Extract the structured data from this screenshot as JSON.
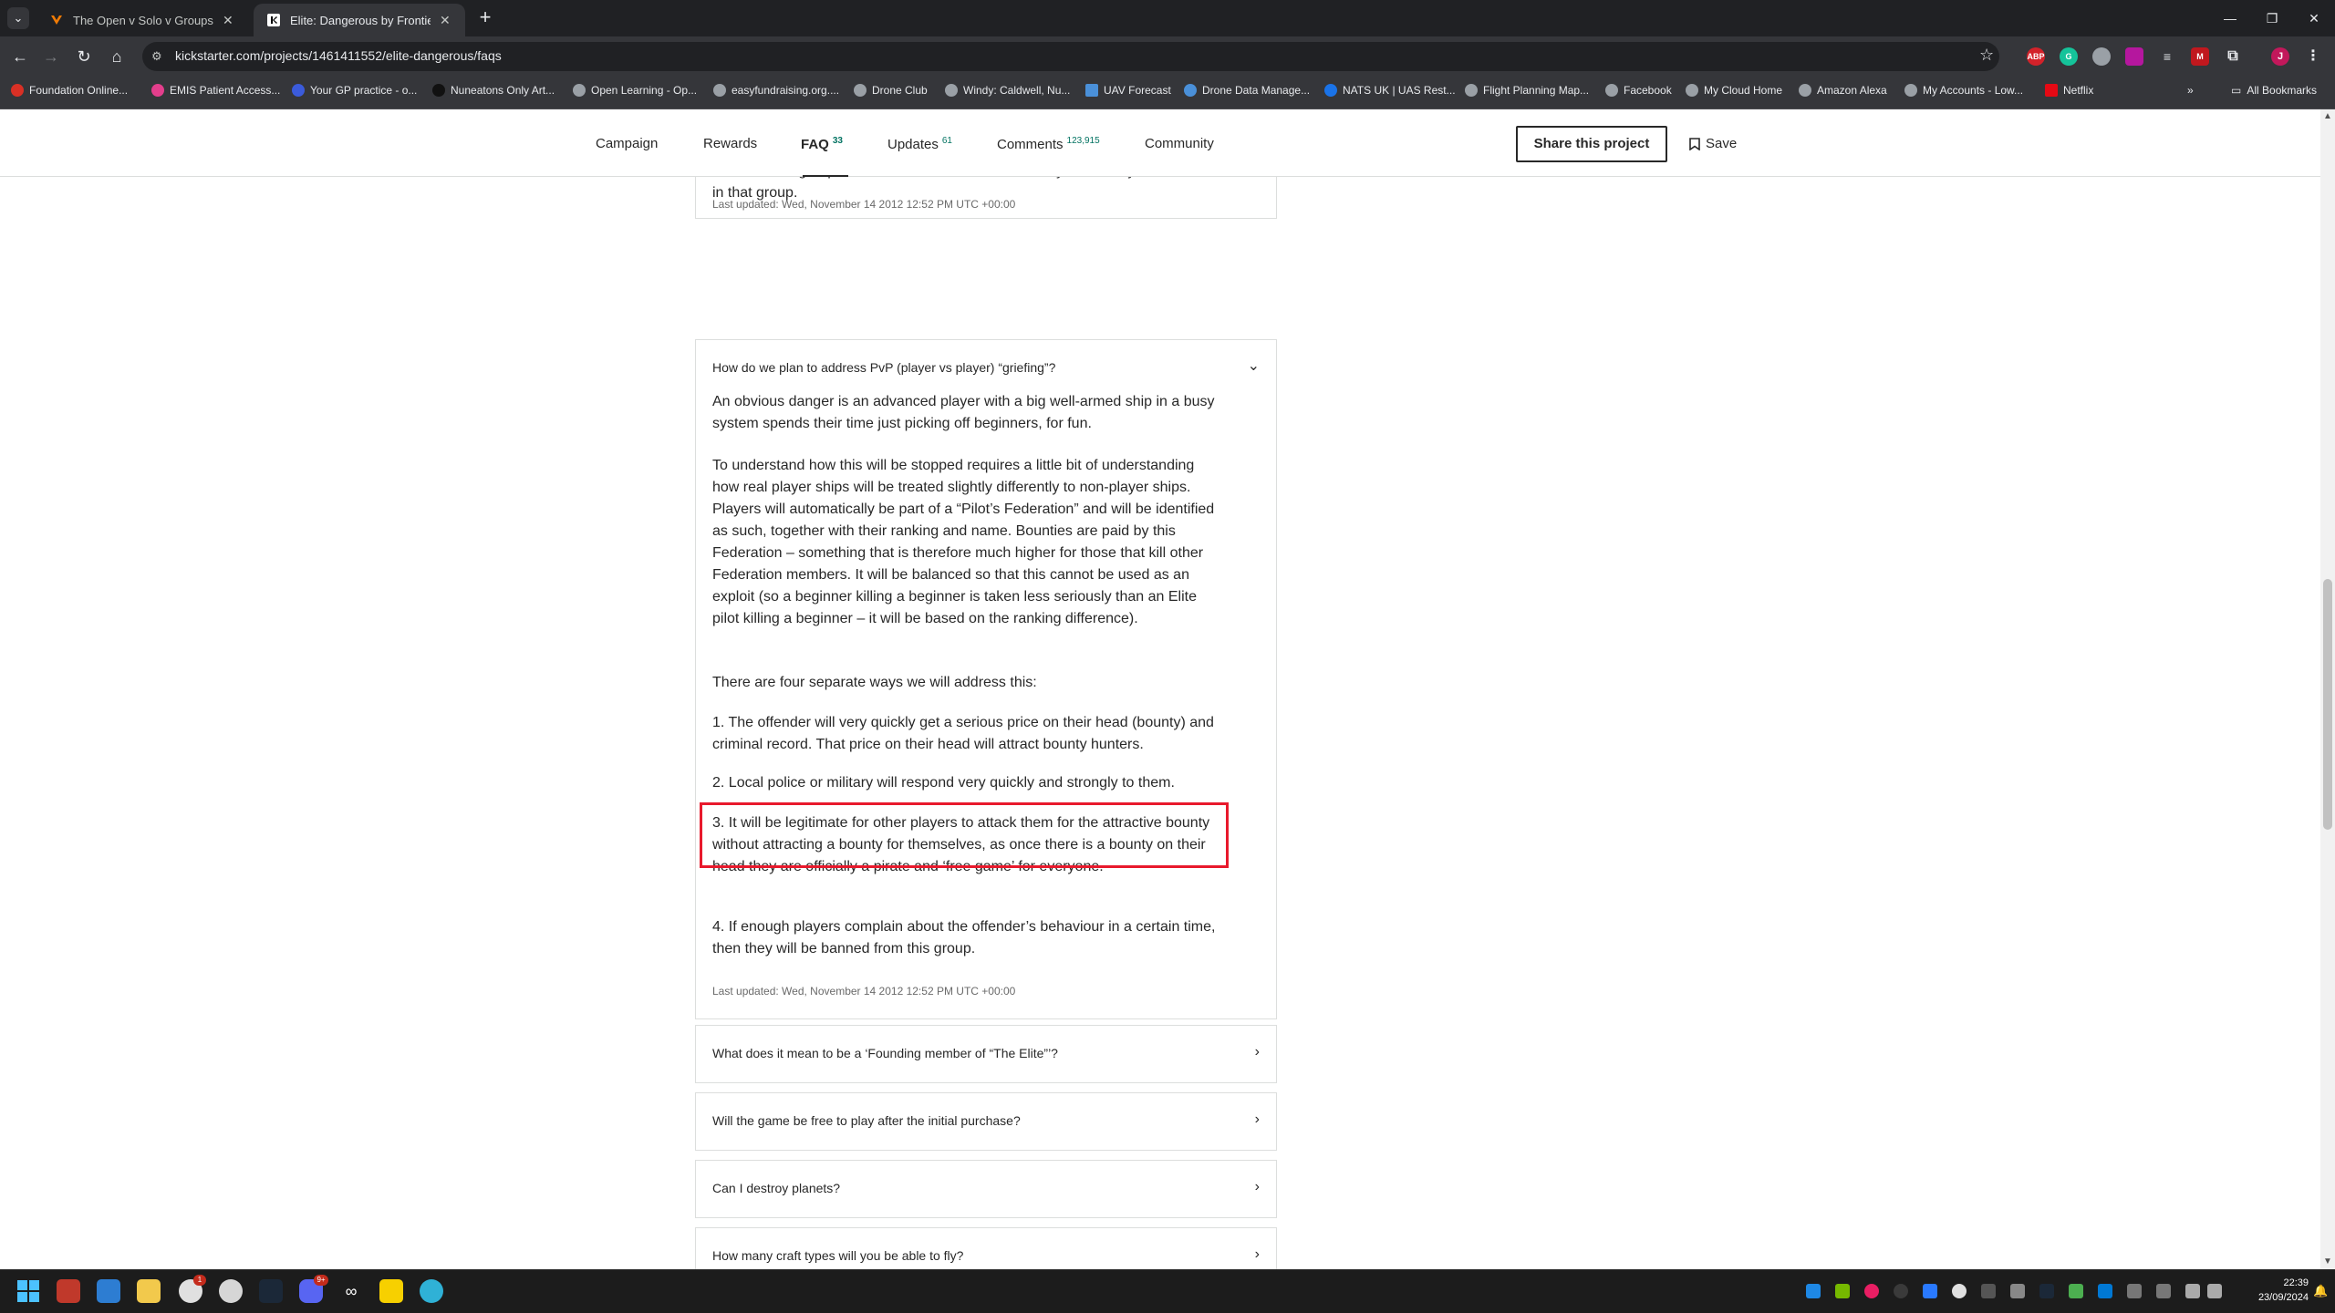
{
  "browser": {
    "tabs": [
      {
        "title": "The Open v Solo v Groups thre",
        "active": false
      },
      {
        "title": "Elite: Dangerous by Frontier De",
        "active": true
      }
    ],
    "url": "kickstarter.com/projects/1461411552/elite-dangerous/faqs",
    "bookmarks": [
      "Foundation Online...",
      "EMIS Patient Access...",
      "Your GP practice - o...",
      "Nuneatons Only Art...",
      "Open Learning - Op...",
      "easyfundraising.org....",
      "Drone Club",
      "Windy: Caldwell, Nu...",
      "UAV Forecast",
      "Drone Data Manage...",
      "NATS UK | UAS Rest...",
      "Flight Planning Map...",
      "Facebook",
      "My Cloud Home",
      "Amazon Alexa",
      "My Accounts - Low...",
      "Netflix"
    ],
    "all_bookmarks": "All Bookmarks",
    "profile_initial": "J"
  },
  "subnav": {
    "campaign": "Campaign",
    "rewards": "Rewards",
    "faq": "FAQ",
    "faq_count": "33",
    "updates": "Updates",
    "updates_count": "61",
    "comments": "Comments",
    "comments_count": "123,915",
    "community": "Community",
    "share": "Share this project",
    "save": "Save"
  },
  "faq_prev": {
    "lines": "friends or open groups (that form part of the game) based on the play styles people prefer, and the rules in each can be different. Players will begin in the group “All” but can change groups at will, though it will be possible to be banned from groups due to antisocial behaviour, and you will only meet others in that group.",
    "updated": "Last updated: Wed, November 14 2012 12:52 PM UTC +00:00"
  },
  "faq_open": {
    "question": "How do we plan to address PvP (player vs player) “griefing”?",
    "p1": "An obvious danger is an advanced player with a big well-armed ship in a busy system spends their time just picking off beginners, for fun.",
    "p2": "To understand how this will be stopped requires a little bit of understanding how real player ships will be treated slightly differently to non-player ships. Players will automatically be part of a “Pilot’s Federation” and will be identified as such, together with their ranking and name. Bounties are paid by this Federation – something that is therefore much higher for those that kill other Federation members. It will be balanced so that this cannot be used as an exploit (so a beginner killing a beginner is taken less seriously than an Elite pilot killing a beginner – it will be based on the ranking difference).",
    "p3": "There are four separate ways we will address this:",
    "p4": "1. The offender will very quickly get a serious price on their head (bounty) and criminal record. That price on their head will attract bounty hunters.",
    "p5": "2. Local police or military will respond very quickly and strongly to them.",
    "p6": "3. It will be legitimate for other players to attack them for the attractive bounty without attracting a bounty for themselves, as once there is a bounty on their head they are officially a pirate and ‘free game’ for everyone.",
    "p7": "4. If enough players complain about the offender’s behaviour in a certain time, then they will be banned from this group.",
    "updated": "Last updated: Wed, November 14 2012 12:52 PM UTC +00:00"
  },
  "faq_collapsed": [
    "What does it mean to be a ‘Founding member of “The Elite”’?",
    "Will the game be free to play after the initial purchase?",
    "Can I destroy planets?",
    "How many craft types will you be able to fly?"
  ],
  "taskbar": {
    "time": "22:39",
    "date": "23/09/2024",
    "chrome_badge": "1",
    "discord_badge": "9+"
  },
  "colors": {
    "highlight": "#e8192c",
    "accent": "#037362"
  }
}
